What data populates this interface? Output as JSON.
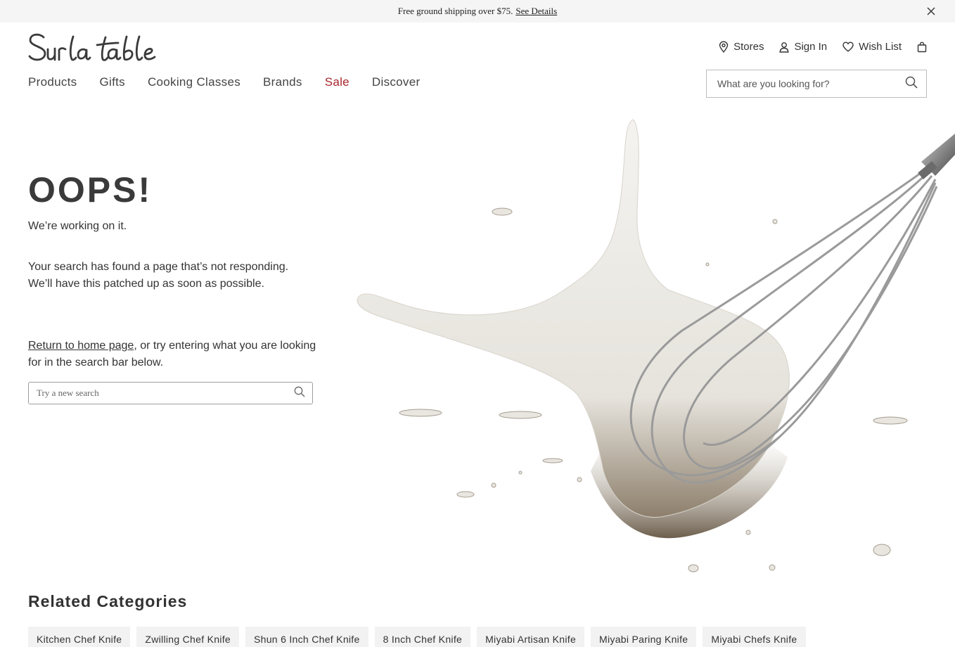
{
  "promo": {
    "text": "Free ground shipping over $75.",
    "link": "See Details"
  },
  "brand": {
    "logo_text": "Sur la table"
  },
  "utility_nav": {
    "stores": "Stores",
    "sign_in": "Sign In",
    "wish_list": "Wish List"
  },
  "main_nav": {
    "items": [
      "Products",
      "Gifts",
      "Cooking Classes",
      "Brands",
      "Sale",
      "Discover"
    ]
  },
  "header_search": {
    "placeholder": "What are you looking for?"
  },
  "error": {
    "title": "OOPS!",
    "subtitle": "We’re working on it.",
    "message_line1": "Your search has found a page that’s not responding.",
    "message_line2": "We’ll have this patched up as soon as possible.",
    "return_link": "Return to home page",
    "return_rest": ", or try entering what you are looking for in the search bar below."
  },
  "page_search": {
    "placeholder": "Try a new search"
  },
  "related": {
    "title": "Related Categories",
    "chips": [
      "Kitchen Chef Knife",
      "Zwilling Chef Knife",
      "Shun 6 Inch Chef Knife",
      "8 Inch Chef Knife",
      "Miyabi Artisan Knife",
      "Miyabi Paring Knife",
      "Miyabi Chefs Knife"
    ]
  },
  "colors": {
    "sale": "#a8252c",
    "text": "#333333",
    "promo_bg": "#f5f5f5",
    "chip_bg": "#f2f2f2"
  },
  "icons": {
    "close": "close-icon",
    "stores": "location-pin-icon",
    "sign_in": "user-icon",
    "wish_list": "heart-icon",
    "cart": "shopping-bag-icon",
    "search": "search-icon"
  }
}
